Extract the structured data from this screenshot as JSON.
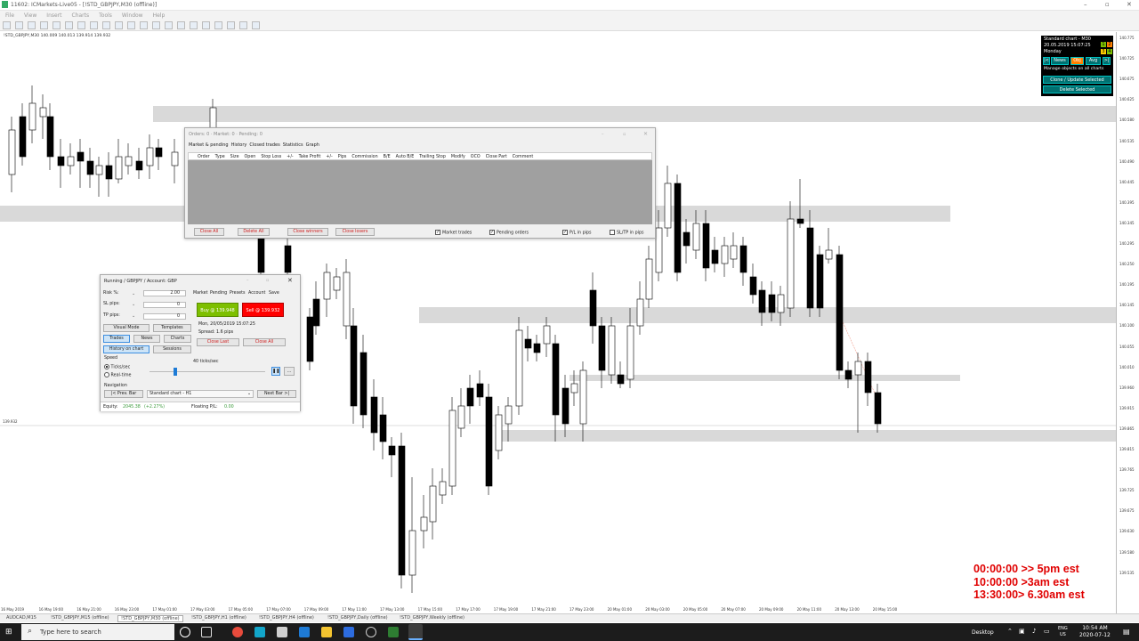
{
  "window": {
    "title": "11602: ICMarkets-Live05 - [!STD_GBPJPY,M30 (offline)]"
  },
  "menu": [
    "File",
    "View",
    "Insert",
    "Charts",
    "Tools",
    "Window",
    "Help"
  ],
  "chart": {
    "ohlc": "!STD_GBPJPY,M30  140.009 140.013 139.914 139.932",
    "bid_marker": "139.932",
    "price_labels": [
      "140.775",
      "140.725",
      "140.675",
      "140.625",
      "140.580",
      "140.535",
      "140.490",
      "140.445",
      "140.395",
      "140.345",
      "140.295",
      "140.250",
      "140.195",
      "140.145",
      "140.100",
      "140.055",
      "140.010",
      "139.960",
      "139.915",
      "139.865",
      "139.815",
      "139.765",
      "139.725",
      "139.675",
      "139.630",
      "139.580",
      "139.535"
    ],
    "time_labels": [
      "16 May 2019",
      "16 May 19:00",
      "16 May 21:00",
      "16 May 23:00",
      "17 May 01:00",
      "17 May 03:00",
      "17 May 05:00",
      "17 May 07:00",
      "17 May 09:00",
      "17 May 11:00",
      "17 May 13:00",
      "17 May 15:00",
      "17 May 17:00",
      "17 May 19:00",
      "17 May 21:00",
      "17 May 23:00",
      "20 May 01:00",
      "20 May 03:00",
      "20 May 05:00",
      "20 May 07:00",
      "20 May 09:00",
      "20 May 11:00",
      "20 May 13:00",
      "20 May 15:00"
    ]
  },
  "orders": {
    "header": "Orders: 0 · Market: 0 · Pending: 0",
    "tabs": [
      "Market & pending",
      "History",
      "Closed trades",
      "Statistics",
      "Graph"
    ],
    "columns": [
      "Order",
      "Type",
      "Size",
      "Open",
      "Stop Loss",
      "+/-",
      "Take Profit",
      "+/-",
      "Pips",
      "Commission",
      "B/E",
      "Auto B/E",
      "Trailing Stop",
      "Modify",
      "OCO",
      "Close Part",
      "Comment"
    ],
    "buttons": {
      "close_all": "Close All",
      "delete_all": "Delete All",
      "close_winners": "Close winners",
      "close_losers": "Close losers"
    },
    "checks": {
      "market": "Market trades",
      "pending": "Pending orders",
      "pl_pips": "P/L in pips",
      "sltp_pips": "SL/TP in pips"
    }
  },
  "sim": {
    "title": "Running / GBPJPY / Account: GBP",
    "risk_label": "Risk %:",
    "risk_value": "2.00",
    "sl_label": "SL pips:",
    "sl_value": "0",
    "tp_label": "TP pips:",
    "tp_value": "0",
    "tabs": [
      "Market",
      "Pending",
      "Presets",
      "Account",
      "Save"
    ],
    "buy": "Buy @ 139.948",
    "sell": "Sell @ 139.932",
    "datetime": "Mon, 20/05/2019   15:07:25",
    "spread": "Spread: 1.6 pips",
    "close_last": "Close Last",
    "close_all": "Close All",
    "visual_mode": "Visual Mode",
    "templates": "Templates",
    "trades": "Trades",
    "news": "News",
    "charts": "Charts",
    "history": "History on chart",
    "sessions": "Sessions",
    "speed_label": "Speed",
    "speed_value": "40 ticks/sec",
    "ticks": "Ticks/sec",
    "realtime": "Real-time",
    "nav_label": "Navigation",
    "prev": "|< Prev. Bar",
    "nav_select": "Standard chart - H1",
    "next": "Next Bar >|",
    "equity_label": "Equity:",
    "equity_value": "2045.38",
    "equity_change": "(+2.27%)",
    "floating_label": "Floating P/L:",
    "floating_value": "0.00"
  },
  "panel": {
    "line1": "Standard chart - M30",
    "line2": "20.05.2019   15:07:25",
    "line3": "Monday",
    "nums": [
      "1",
      "2",
      "3",
      "4"
    ],
    "btn_prev": "|<",
    "btn_news": "News",
    "btn_obj": "Obj",
    "btn_avg": "Avg",
    "btn_next": ">|",
    "manage": "Manage objects on all charts",
    "clone": "Clone / Update Selected",
    "delete": "Delete Selected"
  },
  "notes": [
    "00:00:00 >> 5pm est",
    "10:00:00 >3am est",
    "13:30:00> 6.30am est"
  ],
  "tabsbar": [
    "AUDCAD,M15",
    "!STD_GBPJPY,M15 (offline)",
    "!STD_GBPJPY,M30 (offline)",
    "!STD_GBPJPY,H1 (offline)",
    "!STD_GBPJPY,H4 (offline)",
    "!STD_GBPJPY,Daily (offline)",
    "!STD_GBPJPY,Weekly (offline)"
  ],
  "taskbar": {
    "search": "Type here to search",
    "desktop": "Desktop",
    "lang": "ENG",
    "region": "US",
    "time": "10:54 AM",
    "date": "2020-07-12"
  }
}
